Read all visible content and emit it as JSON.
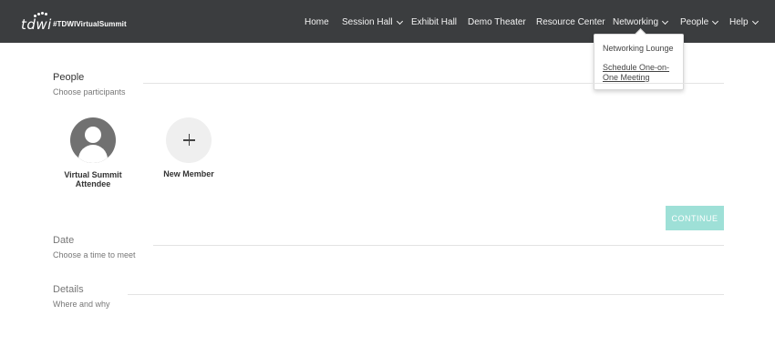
{
  "header": {
    "logo_text": "tdwi",
    "hashtag": "#TDWIVirtualSummit",
    "nav": [
      {
        "label": "Home"
      },
      {
        "label": "Session Hall"
      },
      {
        "label": "Exhibit Hall"
      },
      {
        "label": "Demo Theater"
      },
      {
        "label": "Resource Center"
      },
      {
        "label": "Networking"
      },
      {
        "label": "People"
      },
      {
        "label": "Help"
      }
    ],
    "active_nav": "Networking",
    "accent_color": "#6fd3c3"
  },
  "networking_menu": {
    "items": [
      {
        "label": "Networking Lounge"
      },
      {
        "label": "Schedule One-on-One Meeting"
      }
    ]
  },
  "people": {
    "title": "People",
    "subtitle": "Choose participants",
    "members": [
      {
        "name": "Virtual Summit Attendee",
        "icon": "user-avatar-icon"
      },
      {
        "name": "New Member",
        "icon": "plus-icon"
      }
    ],
    "continue_label": "CONTINUE"
  },
  "date": {
    "title": "Date",
    "subtitle": "Choose a time to meet"
  },
  "details": {
    "title": "Details",
    "subtitle": "Where and why"
  }
}
